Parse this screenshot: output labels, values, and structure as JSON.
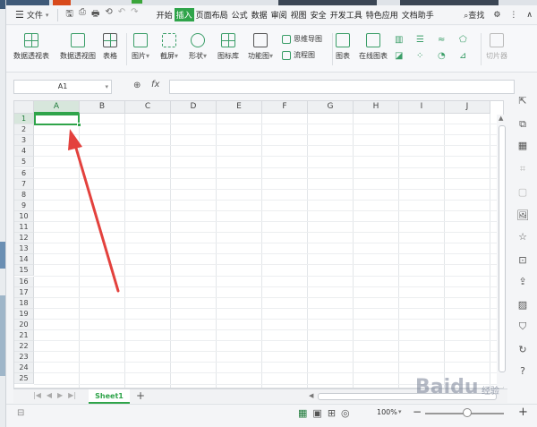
{
  "menubar": {
    "file_label": "文件",
    "tabs": [
      "开始",
      "插入",
      "页面布局",
      "公式",
      "数据",
      "审阅",
      "视图",
      "安全",
      "开发工具",
      "特色应用",
      "文档助手"
    ],
    "active_tab": "插入",
    "search_label": "查找"
  },
  "ribbon": {
    "pivot_table": "数据透视表",
    "pivot_chart": "数据透视图",
    "table": "表格",
    "picture": "图片",
    "screenshot": "截屏",
    "shape": "形状",
    "icon_library": "图标库",
    "function_chart": "功能图",
    "mind_map": "思维导图",
    "flowchart": "流程图",
    "chart": "图表",
    "online_chart": "在线图表",
    "slicer": "切片器"
  },
  "formula_bar": {
    "name_box": "A1",
    "fx_label": "fx",
    "value": ""
  },
  "grid": {
    "columns": [
      "A",
      "B",
      "C",
      "D",
      "E",
      "F",
      "G",
      "H",
      "I",
      "J"
    ],
    "rows": [
      "1",
      "2",
      "3",
      "4",
      "5",
      "6",
      "7",
      "8",
      "9",
      "10",
      "11",
      "12",
      "13",
      "14",
      "15",
      "16",
      "17",
      "18",
      "19",
      "20",
      "21",
      "22",
      "23",
      "24",
      "25"
    ],
    "active_cell": "A1"
  },
  "sheets": {
    "tabs": [
      "Sheet1"
    ],
    "active": "Sheet1",
    "add_label": "+"
  },
  "statusbar": {
    "zoom": "100%",
    "minus": "−",
    "plus": "+"
  },
  "watermark": {
    "brand": "Baidu",
    "sub": "经验"
  },
  "colors": {
    "accent": "#2fa44a",
    "arrow": "#e3413d"
  }
}
